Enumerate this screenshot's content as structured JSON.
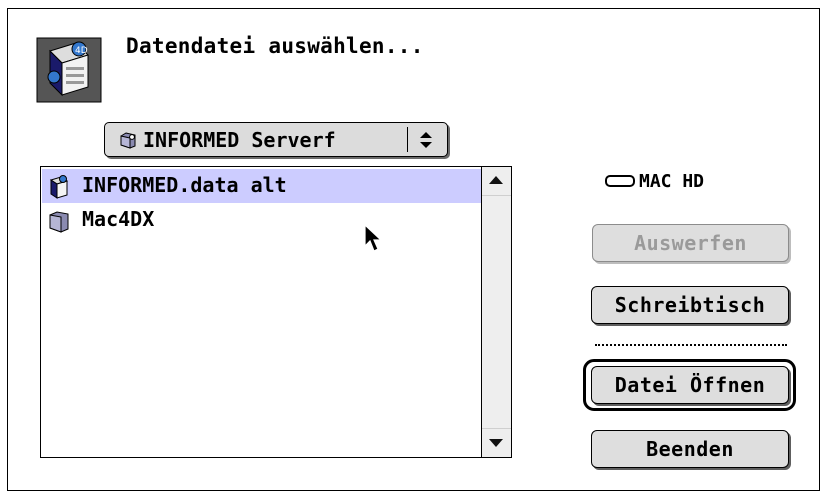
{
  "dialog": {
    "title": "Datendatei auswählen...",
    "app_icon": "4d-database-app-icon"
  },
  "location_popup": {
    "selected": "INFORMED Serverf",
    "icon": "folder-icon",
    "arrows_icon": "up-down-arrows-icon"
  },
  "file_list": {
    "items": [
      {
        "label": "INFORMED.data alt",
        "icon": "4d-data-file-icon",
        "selected": true
      },
      {
        "label": "Mac4DX",
        "icon": "folder-icon",
        "selected": false
      }
    ],
    "selection_color": "#ccccff"
  },
  "volume": {
    "label": "MAC HD",
    "icon": "hard-disk-icon"
  },
  "buttons": {
    "eject": "Auswerfen",
    "desktop": "Schreibtisch",
    "open": "Datei Öffnen",
    "quit": "Beenden"
  }
}
